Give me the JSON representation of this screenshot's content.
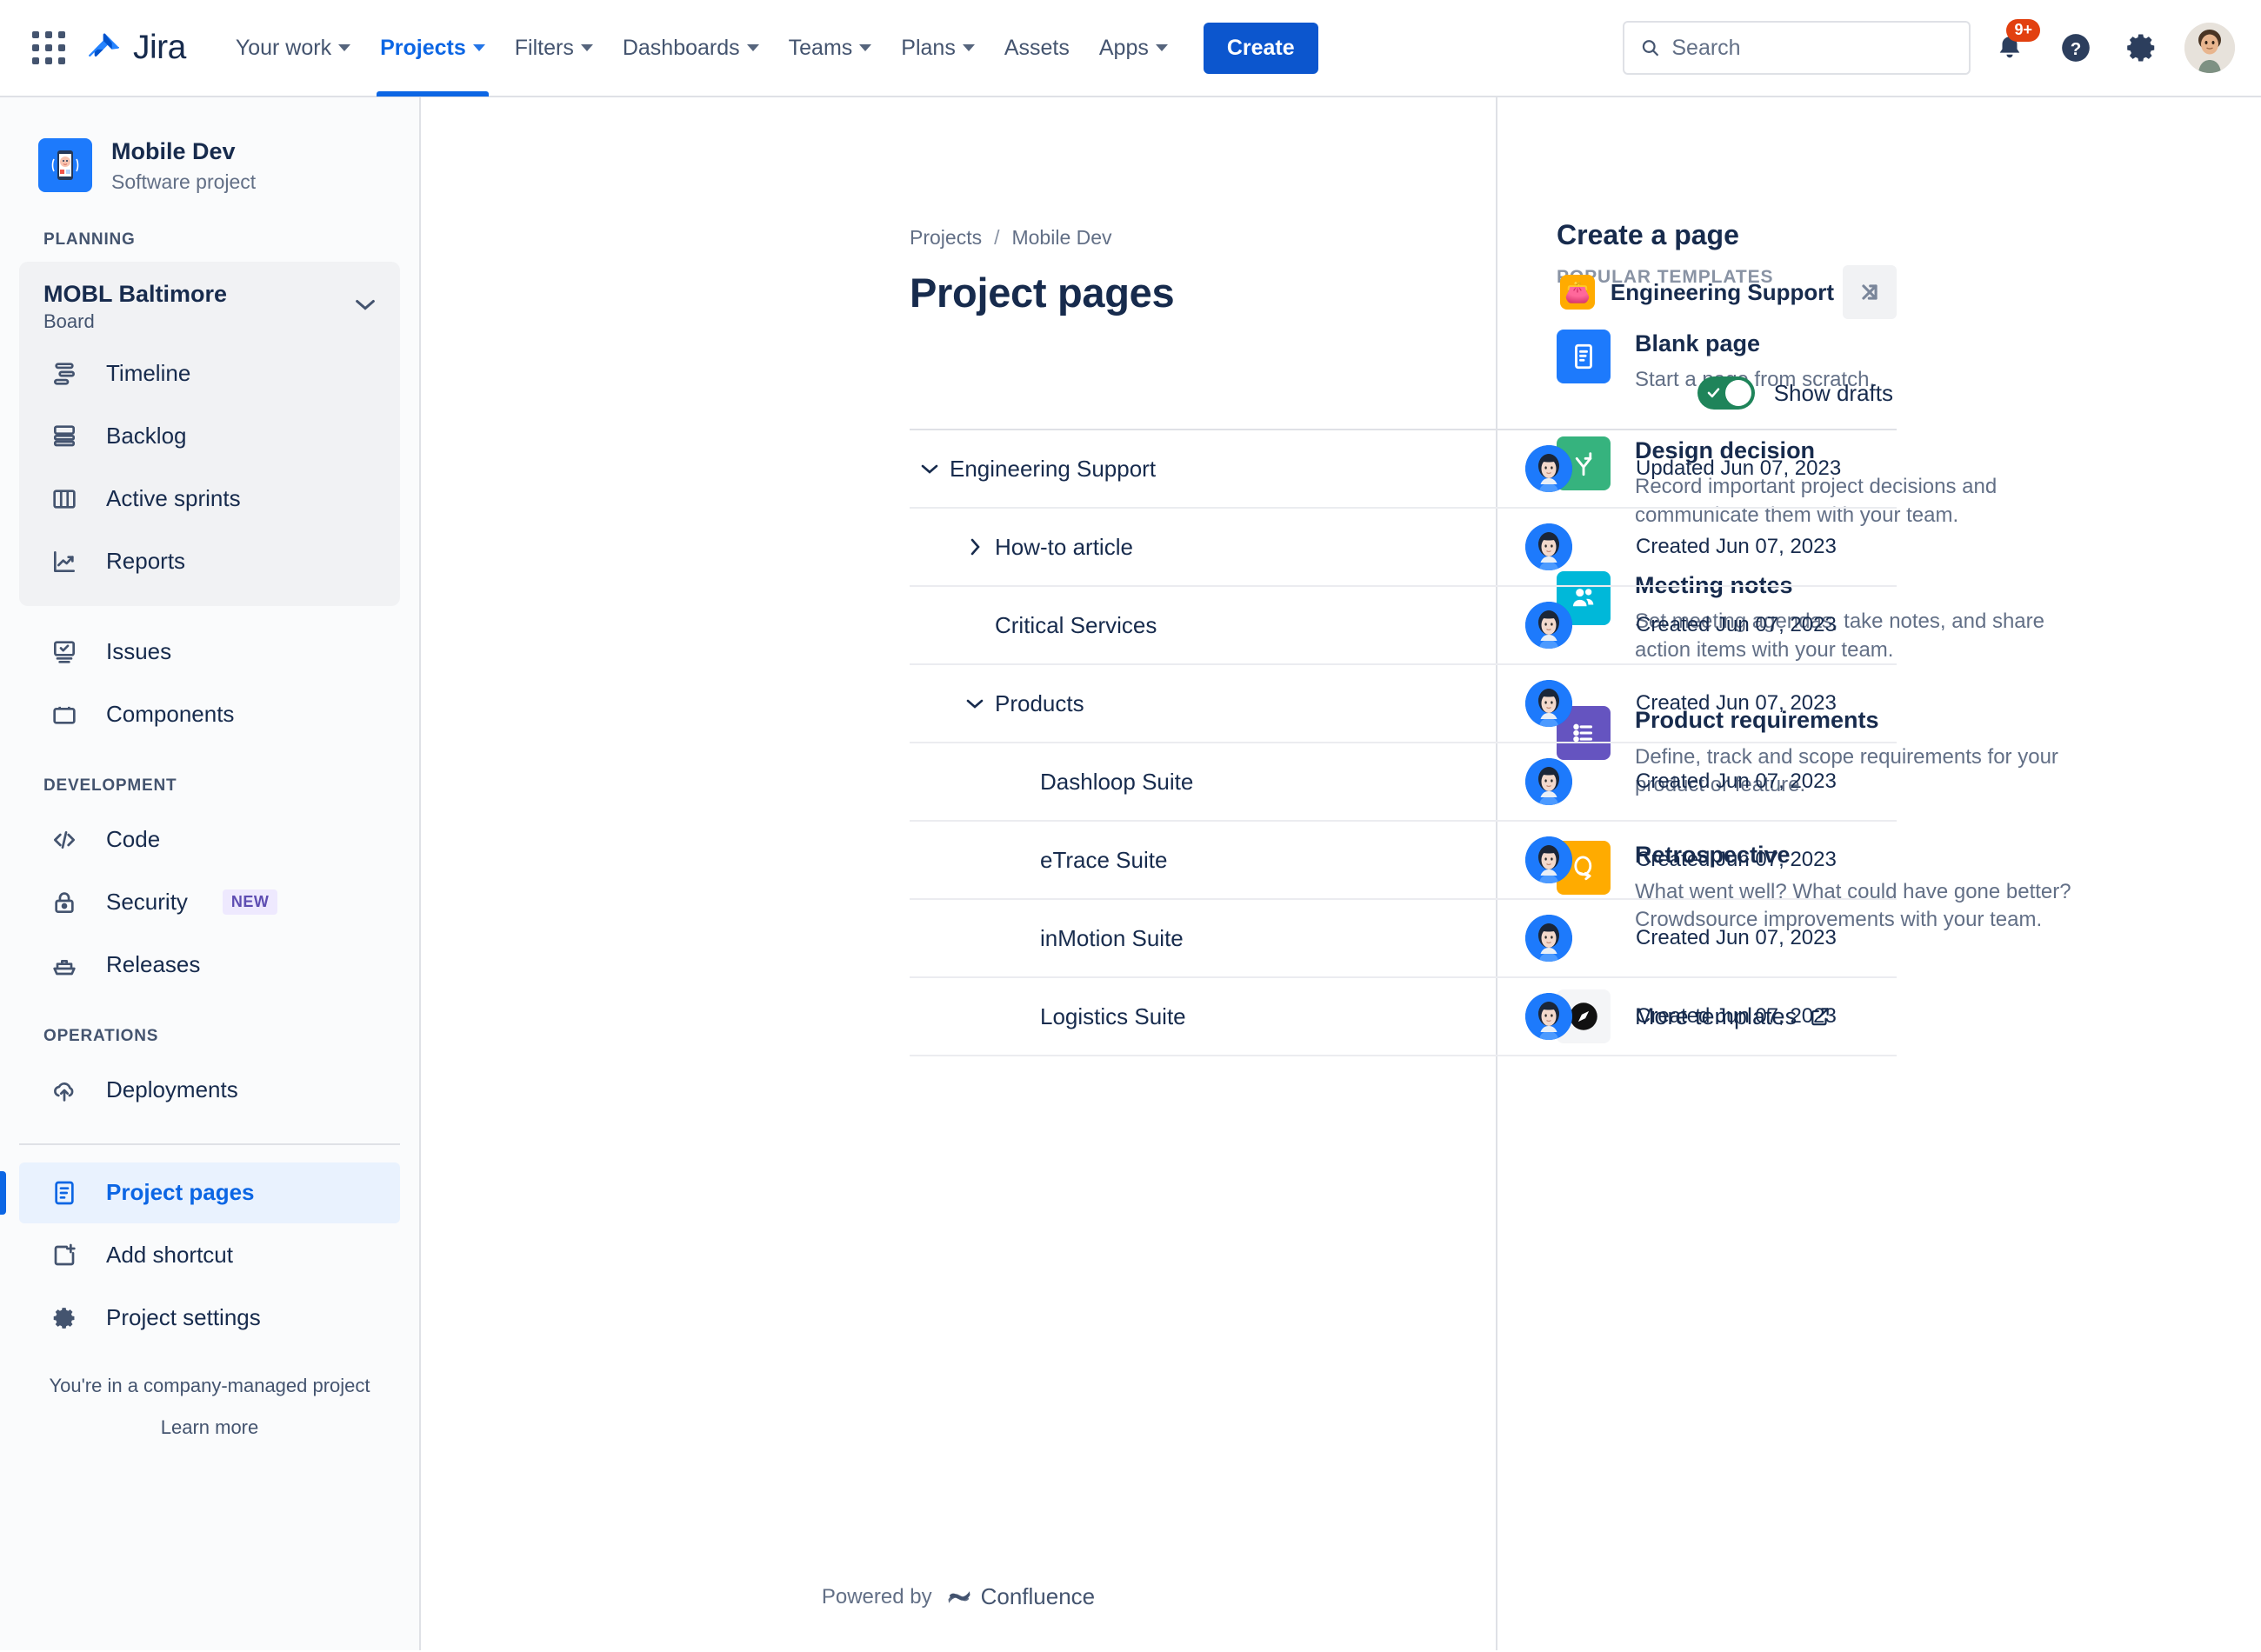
{
  "topnav": {
    "app_switcher_icon": "grid-apps-icon",
    "logo_text": "Jira",
    "items": [
      {
        "label": "Your work",
        "has_chevron": true,
        "active": false
      },
      {
        "label": "Projects",
        "has_chevron": true,
        "active": true
      },
      {
        "label": "Filters",
        "has_chevron": true,
        "active": false
      },
      {
        "label": "Dashboards",
        "has_chevron": true,
        "active": false
      },
      {
        "label": "Teams",
        "has_chevron": true,
        "active": false
      },
      {
        "label": "Plans",
        "has_chevron": true,
        "active": false
      },
      {
        "label": "Assets",
        "has_chevron": false,
        "active": false
      },
      {
        "label": "Apps",
        "has_chevron": true,
        "active": false
      }
    ],
    "create_label": "Create",
    "search": {
      "placeholder": "Search",
      "value": ""
    },
    "notifications_badge": "9+",
    "help_icon": "question-circle-icon",
    "settings_icon": "gear-icon",
    "avatar_icon": "user-avatar"
  },
  "sidebar": {
    "project": {
      "name": "Mobile Dev",
      "type": "Software project",
      "icon": "mobile-phone-icon"
    },
    "sections": [
      {
        "label": "PLANNING"
      },
      {
        "label": "DEVELOPMENT"
      },
      {
        "label": "OPERATIONS"
      }
    ],
    "board": {
      "name": "MOBL Baltimore",
      "subtitle": "Board"
    },
    "planning_items": [
      {
        "label": "Timeline",
        "icon": "timeline-icon"
      },
      {
        "label": "Backlog",
        "icon": "backlog-icon"
      },
      {
        "label": "Active sprints",
        "icon": "board-columns-icon"
      },
      {
        "label": "Reports",
        "icon": "chart-trend-icon"
      }
    ],
    "general_items": [
      {
        "label": "Issues",
        "icon": "issues-icon"
      },
      {
        "label": "Components",
        "icon": "components-icon"
      }
    ],
    "development_items": [
      {
        "label": "Code",
        "icon": "code-icon",
        "badge": ""
      },
      {
        "label": "Security",
        "icon": "lock-icon",
        "badge": "NEW"
      },
      {
        "label": "Releases",
        "icon": "ship-icon",
        "badge": ""
      }
    ],
    "operations_items": [
      {
        "label": "Deployments",
        "icon": "cloud-upload-icon"
      }
    ],
    "bottom_items": [
      {
        "label": "Project pages",
        "icon": "page-icon",
        "selected": true
      },
      {
        "label": "Add shortcut",
        "icon": "add-shortcut-icon",
        "selected": false
      },
      {
        "label": "Project settings",
        "icon": "gear-icon",
        "selected": false
      }
    ],
    "footer_note": "You're in a company-managed project",
    "footer_link": "Learn more"
  },
  "main": {
    "breadcrumb": [
      "Projects",
      "/",
      "Mobile Dev"
    ],
    "title": "Project pages",
    "space": {
      "name": "Engineering Support",
      "emoji": "👛",
      "sync_icon": "sync-arrows-icon"
    },
    "show_drafts_label": "Show drafts",
    "show_drafts_on": true,
    "rows": [
      {
        "label": "Engineering Support",
        "indent": 0,
        "twisty": "down",
        "date": "Updated Jun 07, 2023"
      },
      {
        "label": "How-to article",
        "indent": 1,
        "twisty": "right",
        "date": "Created Jun 07, 2023"
      },
      {
        "label": "Critical Services",
        "indent": 1,
        "twisty": "none",
        "date": "Created Jun 07, 2023"
      },
      {
        "label": "Products",
        "indent": 1,
        "twisty": "down",
        "date": "Created Jun 07, 2023"
      },
      {
        "label": "Dashloop Suite",
        "indent": 2,
        "twisty": "none",
        "date": "Created Jun 07, 2023"
      },
      {
        "label": "eTrace Suite",
        "indent": 2,
        "twisty": "none",
        "date": "Created Jun 07, 2023"
      },
      {
        "label": "inMotion Suite",
        "indent": 2,
        "twisty": "none",
        "date": "Created Jun 07, 2023"
      },
      {
        "label": "Logistics Suite",
        "indent": 2,
        "twisty": "none",
        "date": "Created Jun 07, 2023"
      }
    ],
    "powered_by": "Powered by",
    "powered_brand": "Confluence"
  },
  "rightpanel": {
    "title": "Create a page",
    "subtitle": "POPULAR TEMPLATES",
    "templates": [
      {
        "name": "Blank page",
        "desc": "Start a page from scratch.",
        "icon": "blank-page-icon",
        "color": "#1D7AFC"
      },
      {
        "name": "Design decision",
        "desc": "Record important project decisions and communicate them with your team.",
        "icon": "branch-decision-icon",
        "color": "#36B37E"
      },
      {
        "name": "Meeting notes",
        "desc": "Set meeting agendas, take notes, and share action items with your team.",
        "icon": "people-icon",
        "color": "#00B8D9"
      },
      {
        "name": "Product requirements",
        "desc": "Define, track and scope requirements for your product or feature.",
        "icon": "list-icon",
        "color": "#6554C0"
      },
      {
        "name": "Retrospective",
        "desc": "What went well? What could have gone better? Crowdsource improvements with your team.",
        "icon": "retro-loop-icon",
        "color": "#FFAB00"
      }
    ],
    "more_templates_label": "More templates",
    "more_templates_icon": "compass-icon",
    "external_link_icon": "external-link-icon"
  },
  "colors": {
    "brand_blue": "#0C66E4",
    "create_blue": "#0C56CE",
    "green_toggle": "#1F845A",
    "badge_red": "#E2400F",
    "text": "#172B4D",
    "subtle_text": "#626F86",
    "border": "#DFE1E6"
  }
}
